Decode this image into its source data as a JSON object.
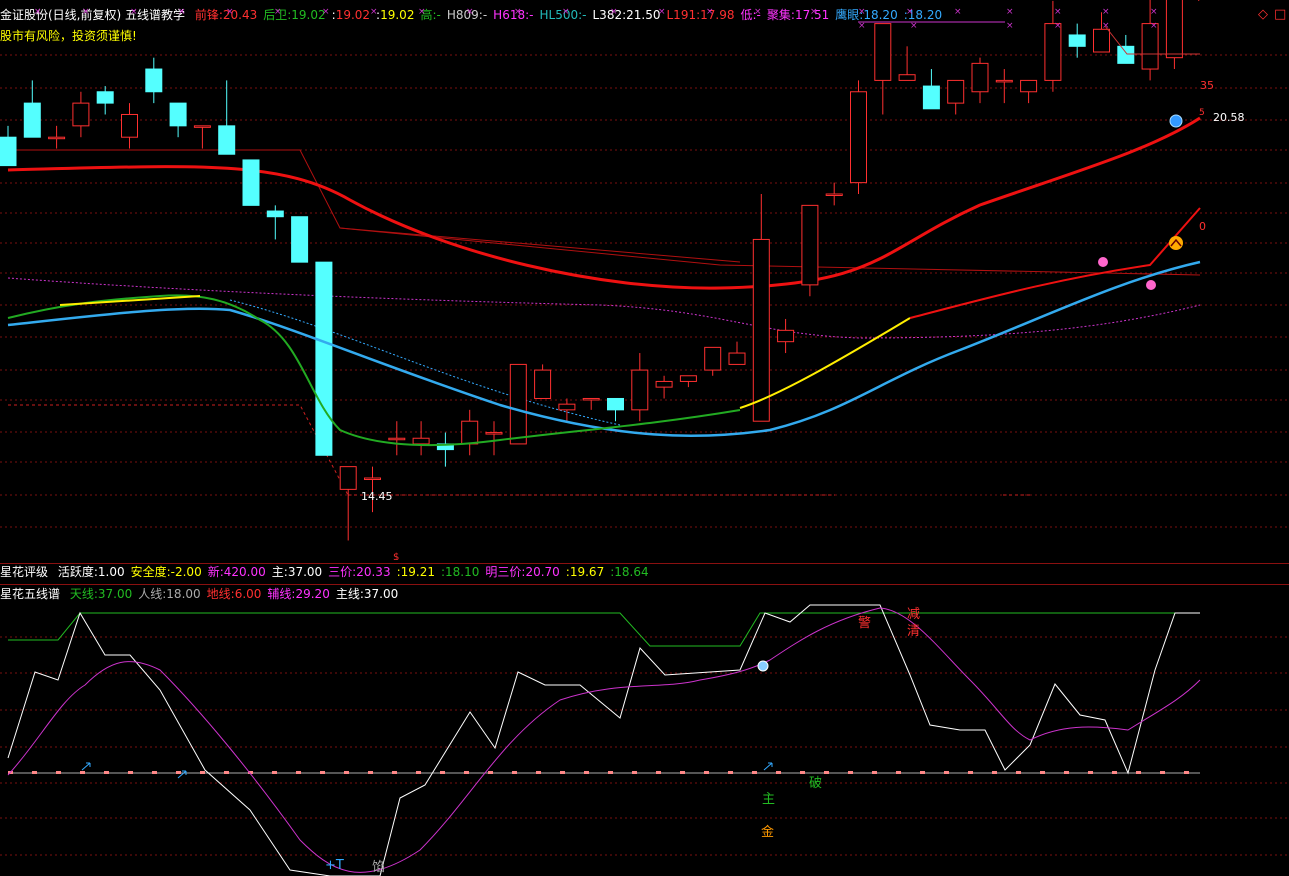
{
  "header": {
    "title": "金证股份(日线,前复权) 五线谱教学",
    "items": [
      {
        "label": "前锋:",
        "value": "20.43",
        "lc": "#ff3030",
        "vc": "#ff3030"
      },
      {
        "label": "后卫:",
        "value": "19.02",
        "lc": "#22bb22",
        "vc": "#22bb22"
      },
      {
        "label": ":",
        "value": "19.02",
        "lc": "#ffffff",
        "vc": "#ff3030"
      },
      {
        "label": ":",
        "value": "19.02",
        "lc": "#ffffff",
        "vc": "#ffff00"
      },
      {
        "label": "高:",
        "value": "-",
        "lc": "#22bb22",
        "vc": "#22bb22"
      },
      {
        "label": "H809:",
        "value": "-",
        "lc": "#cccccc",
        "vc": "#cccccc"
      },
      {
        "label": "H618:",
        "value": "-",
        "lc": "#ff33ff",
        "vc": "#ff33ff"
      },
      {
        "label": "HL500:",
        "value": "-",
        "lc": "#22bbbb",
        "vc": "#22bbbb"
      },
      {
        "label": "L382:",
        "value": "21.50",
        "lc": "#ffffff",
        "vc": "#ffffff"
      },
      {
        "label": "L191:",
        "value": "17.98",
        "lc": "#ff3030",
        "vc": "#ff3030"
      },
      {
        "label": "低:",
        "value": "-",
        "lc": "#ff33ff",
        "vc": "#ff33ff"
      },
      {
        "label": "聚集:",
        "value": "17.51",
        "lc": "#ff33ff",
        "vc": "#ff33ff"
      },
      {
        "label": "鹰眼:",
        "value": "18.20",
        "lc": "#33aaff",
        "vc": "#33aaff"
      },
      {
        "label": ":",
        "value": "18.20",
        "lc": "#33aaff",
        "vc": "#33aaff"
      }
    ],
    "risk_notice": "股市有风险，投资须谨慎!"
  },
  "price_labels": {
    "high_mark": "20.58",
    "low_mark": "14.45",
    "right_35": "35",
    "right_0": "0",
    "right_tiny": "5"
  },
  "indicator1": {
    "name": "星花评级",
    "items": [
      {
        "label": "活跃度:",
        "value": "1.00",
        "c": "#ffffff"
      },
      {
        "label": "安全度:",
        "value": "-2.00",
        "c": "#ffff00"
      },
      {
        "label": "新:",
        "value": "420.00",
        "c": "#ff33ff"
      },
      {
        "label": "主:",
        "value": "37.00",
        "c": "#ffffff"
      },
      {
        "label": "三价:",
        "value": "20.33",
        "c": "#ff33ff"
      },
      {
        "label": ":",
        "value": "19.21",
        "c": "#ffff00"
      },
      {
        "label": ":",
        "value": "18.10",
        "c": "#22bb22"
      },
      {
        "label": "明三价:",
        "value": "20.70",
        "c": "#ff33ff"
      },
      {
        "label": ":",
        "value": "19.67",
        "c": "#ffff00"
      },
      {
        "label": ":",
        "value": "18.64",
        "c": "#22bb22"
      }
    ]
  },
  "indicator2": {
    "name": "星花五线谱",
    "items": [
      {
        "label": "天线:",
        "value": "37.00",
        "c": "#22bb22"
      },
      {
        "label": "人线:",
        "value": "18.00",
        "c": "#aaaaaa"
      },
      {
        "label": "地线:",
        "value": "6.00",
        "c": "#ff3030"
      },
      {
        "label": "辅线:",
        "value": "29.20",
        "c": "#ff33ff"
      },
      {
        "label": "主线:",
        "value": "37.00",
        "c": "#ffffff"
      }
    ],
    "signals": [
      {
        "text": "警",
        "color": "#ff3030"
      },
      {
        "text": "减",
        "color": "#ff3030"
      },
      {
        "text": "清",
        "color": "#ff3030"
      },
      {
        "text": "破",
        "color": "#22bb22"
      },
      {
        "text": "主",
        "color": "#22bb22"
      },
      {
        "text": "金",
        "color": "#ff9900"
      },
      {
        "text": "+T",
        "color": "#33aaff"
      },
      {
        "text": "馅",
        "color": "#aaaaaa"
      }
    ]
  },
  "chart_data": {
    "type": "candlestick",
    "series": [
      {
        "name": "K",
        "ohlc": [
          [
            18.0,
            18.1,
            17.75,
            17.75
          ],
          [
            18.3,
            18.5,
            18.0,
            18.0
          ],
          [
            18.0,
            18.1,
            17.9,
            18.0
          ],
          [
            18.1,
            18.4,
            18.0,
            18.3
          ],
          [
            18.4,
            18.45,
            18.2,
            18.3
          ],
          [
            18.0,
            18.3,
            17.9,
            18.2
          ],
          [
            18.6,
            18.7,
            18.3,
            18.4
          ],
          [
            18.3,
            18.3,
            18.0,
            18.1
          ],
          [
            18.1,
            18.1,
            17.9,
            18.1
          ],
          [
            18.1,
            18.5,
            17.85,
            17.85
          ],
          [
            17.8,
            17.8,
            17.4,
            17.4
          ],
          [
            17.35,
            17.4,
            17.1,
            17.3
          ],
          [
            17.3,
            17.3,
            16.9,
            16.9
          ],
          [
            16.9,
            16.9,
            15.2,
            15.2
          ],
          [
            14.9,
            15.1,
            14.45,
            15.1
          ],
          [
            15.0,
            15.1,
            14.7,
            15.0
          ],
          [
            15.35,
            15.5,
            15.2,
            15.35
          ],
          [
            15.3,
            15.5,
            15.2,
            15.35
          ],
          [
            15.3,
            15.4,
            15.1,
            15.25
          ],
          [
            15.3,
            15.6,
            15.2,
            15.5
          ],
          [
            15.4,
            15.5,
            15.2,
            15.4
          ],
          [
            15.3,
            16.0,
            15.3,
            16.0
          ],
          [
            15.7,
            16.0,
            15.7,
            15.95
          ],
          [
            15.6,
            15.7,
            15.5,
            15.65
          ],
          [
            15.7,
            15.7,
            15.6,
            15.7
          ],
          [
            15.7,
            15.7,
            15.5,
            15.6
          ],
          [
            15.6,
            16.1,
            15.5,
            15.95
          ],
          [
            15.8,
            15.9,
            15.7,
            15.85
          ],
          [
            15.85,
            15.9,
            15.8,
            15.9
          ],
          [
            15.95,
            16.1,
            15.9,
            16.15
          ],
          [
            16.0,
            16.2,
            16.0,
            16.1
          ],
          [
            15.5,
            17.5,
            15.5,
            17.1
          ],
          [
            16.2,
            16.4,
            16.1,
            16.3
          ],
          [
            16.7,
            17.2,
            16.6,
            17.4
          ],
          [
            17.5,
            17.6,
            17.4,
            17.5
          ],
          [
            17.6,
            18.5,
            17.5,
            18.4
          ],
          [
            18.5,
            19.0,
            18.2,
            19.0
          ],
          [
            18.5,
            18.8,
            18.5,
            18.55
          ],
          [
            18.45,
            18.6,
            18.25,
            18.25
          ],
          [
            18.3,
            18.5,
            18.2,
            18.5
          ],
          [
            18.4,
            18.7,
            18.3,
            18.65
          ],
          [
            18.5,
            18.6,
            18.3,
            18.5
          ],
          [
            18.4,
            18.5,
            18.3,
            18.5
          ],
          [
            18.5,
            19.2,
            18.4,
            19.0
          ],
          [
            18.9,
            19.0,
            18.7,
            18.8
          ],
          [
            18.75,
            19.1,
            18.75,
            18.95
          ],
          [
            18.8,
            18.9,
            18.65,
            18.65
          ],
          [
            18.6,
            19.6,
            18.5,
            19.0
          ],
          [
            18.7,
            20.2,
            18.6,
            20.2
          ],
          [
            20.2,
            20.58,
            19.2,
            20.58
          ]
        ]
      }
    ]
  }
}
